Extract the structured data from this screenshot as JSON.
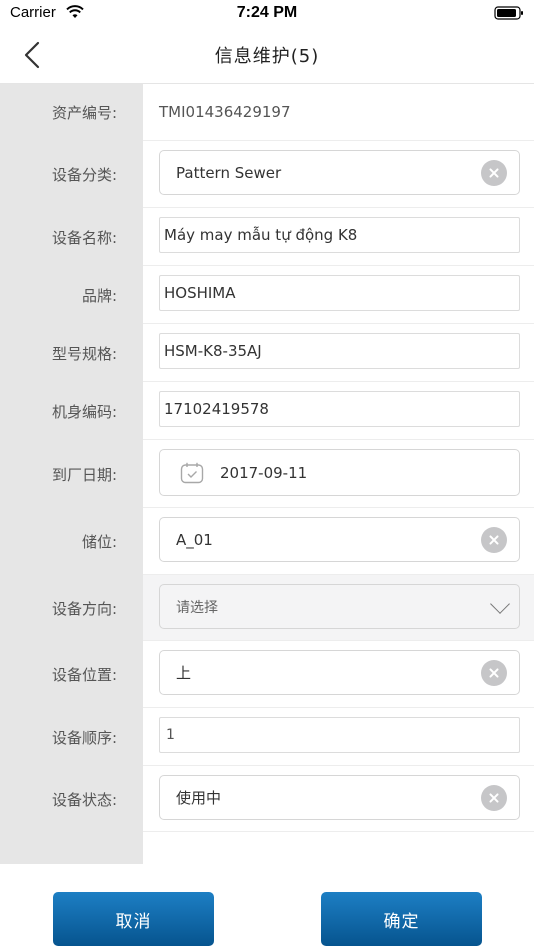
{
  "status_bar": {
    "carrier": "Carrier",
    "time": "7:24 PM"
  },
  "nav": {
    "title": "信息维护(5)"
  },
  "form": {
    "asset_no": {
      "label": "资产编号:",
      "value": "TMI01436429197"
    },
    "category": {
      "label": "设备分类:",
      "value": "Pattern Sewer"
    },
    "name": {
      "label": "设备名称:",
      "value": "Máy may mẫu tự động K8"
    },
    "brand": {
      "label": "品牌:",
      "value": "HOSHIMA"
    },
    "model": {
      "label": "型号规格:",
      "value": "HSM-K8-35AJ"
    },
    "serial": {
      "label": "机身编码:",
      "value": "17102419578"
    },
    "arrival_date": {
      "label": "到厂日期:",
      "value": "2017-09-11"
    },
    "storage": {
      "label": "储位:",
      "value": "A_01"
    },
    "direction": {
      "label": "设备方向:",
      "placeholder": "请选择"
    },
    "position": {
      "label": "设备位置:",
      "value": "上"
    },
    "order": {
      "label": "设备顺序:",
      "value": "1"
    },
    "status": {
      "label": "设备状态:",
      "value": "使用中"
    }
  },
  "footer": {
    "cancel_label": "取消",
    "confirm_label": "确定"
  }
}
